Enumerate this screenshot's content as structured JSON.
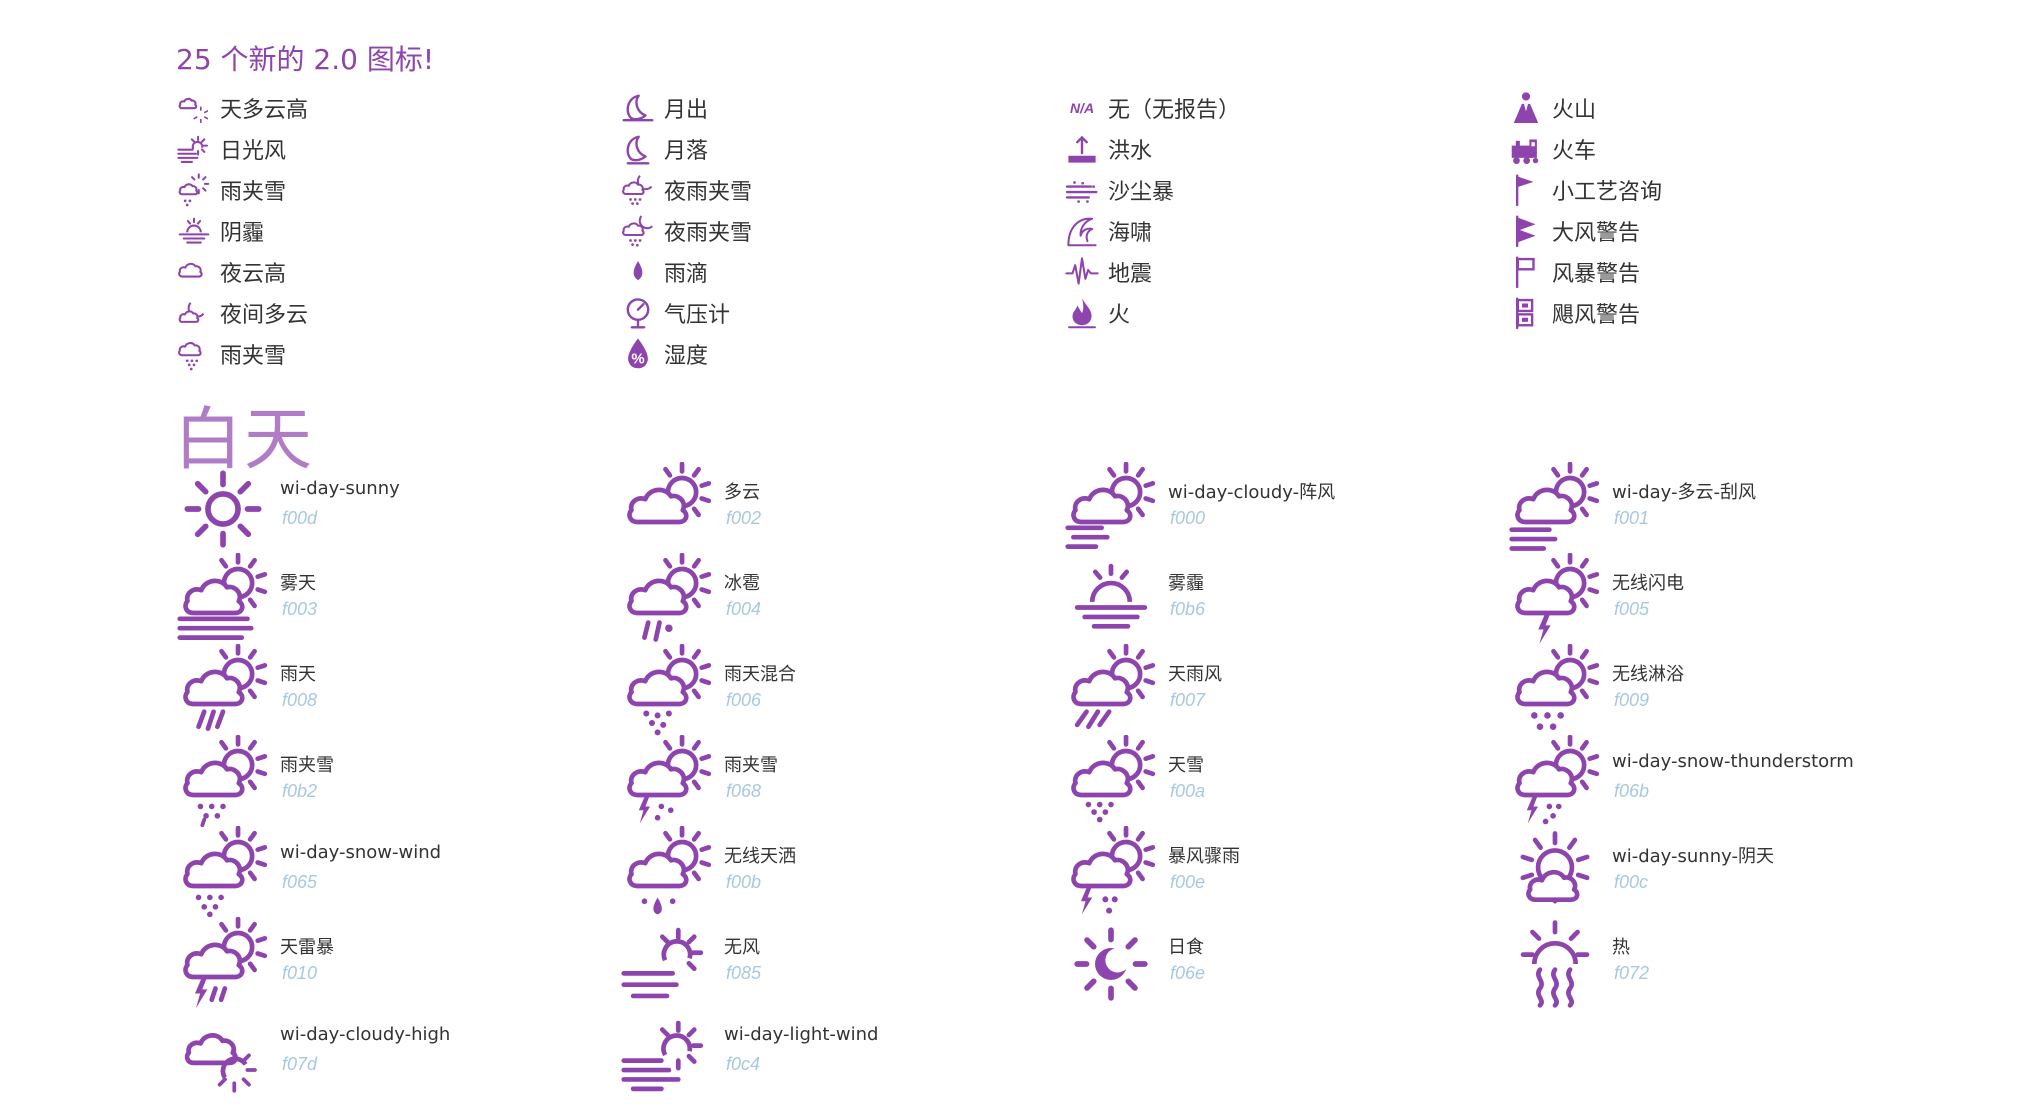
{
  "colors": {
    "accent": "#8e44ad",
    "heading_light": "#b07cc6",
    "code": "#a8c8e0",
    "text": "#333333"
  },
  "new_section": {
    "title": "25 个新的 2.0 图标!",
    "columns": [
      [
        {
          "icon": "day-cloudy-high-icon",
          "label": "天多云高"
        },
        {
          "icon": "day-light-wind-icon",
          "label": "日光风"
        },
        {
          "icon": "day-sleet-icon",
          "label": "雨夹雪"
        },
        {
          "icon": "day-haze-icon",
          "label": "阴霾"
        },
        {
          "icon": "night-cloudy-high-icon",
          "label": "夜云高"
        },
        {
          "icon": "night-partly-cloudy-icon",
          "label": "夜间多云"
        },
        {
          "icon": "sleet-icon",
          "label": "雨夹雪"
        }
      ],
      [
        {
          "icon": "moonrise-icon",
          "label": "月出"
        },
        {
          "icon": "moonset-icon",
          "label": "月落"
        },
        {
          "icon": "night-sleet-icon",
          "label": "夜雨夹雪"
        },
        {
          "icon": "night-alt-sleet-icon",
          "label": "夜雨夹雪"
        },
        {
          "icon": "raindrop-icon",
          "label": "雨滴"
        },
        {
          "icon": "barometer-icon",
          "label": "气压计"
        },
        {
          "icon": "humidity-icon",
          "label": "湿度"
        }
      ],
      [
        {
          "icon": "na-icon",
          "label": "无（无报告）",
          "glyph": "N/A"
        },
        {
          "icon": "flood-icon",
          "label": "洪水"
        },
        {
          "icon": "sandstorm-icon",
          "label": "沙尘暴"
        },
        {
          "icon": "tsunami-icon",
          "label": "海啸"
        },
        {
          "icon": "earthquake-icon",
          "label": "地震"
        },
        {
          "icon": "fire-icon",
          "label": "火"
        }
      ],
      [
        {
          "icon": "volcano-icon",
          "label": "火山"
        },
        {
          "icon": "train-icon",
          "label": "火车"
        },
        {
          "icon": "small-craft-advisory-icon",
          "label": "小工艺咨询"
        },
        {
          "icon": "gale-warning-icon",
          "label": "大风警告"
        },
        {
          "icon": "storm-warning-icon",
          "label": "风暴警告"
        },
        {
          "icon": "hurricane-warning-icon",
          "label": "飓风警告"
        }
      ]
    ]
  },
  "day_section": {
    "heading": "白天",
    "columns": [
      [
        {
          "icon": "day-sunny-icon",
          "name": "wi-day-sunny",
          "code": "f00d"
        },
        {
          "icon": "day-fog-icon",
          "name": "雾天",
          "code": "f003"
        },
        {
          "icon": "day-rain-icon",
          "name": "雨天",
          "code": "f008"
        },
        {
          "icon": "day-sleet-icon",
          "name": "雨夹雪",
          "code": "f0b2"
        },
        {
          "icon": "day-snow-wind-icon",
          "name": "wi-day-snow-wind",
          "code": "f065"
        },
        {
          "icon": "day-thunderstorm-icon",
          "name": "天雷暴",
          "code": "f010"
        },
        {
          "icon": "day-cloudy-high-icon",
          "name": "wi-day-cloudy-high",
          "code": "f07d"
        }
      ],
      [
        {
          "icon": "day-cloudy-icon",
          "name": "多云",
          "code": "f002"
        },
        {
          "icon": "day-hail-icon",
          "name": "冰雹",
          "code": "f004"
        },
        {
          "icon": "day-rain-mix-icon",
          "name": "雨天混合",
          "code": "f006"
        },
        {
          "icon": "day-sleet-storm-icon",
          "name": "雨夹雪",
          "code": "f068"
        },
        {
          "icon": "day-sprinkle-icon",
          "name": "无线天洒",
          "code": "f00b"
        },
        {
          "icon": "day-windy-icon",
          "name": "无风",
          "code": "f085"
        },
        {
          "icon": "day-light-wind-icon",
          "name": "wi-day-light-wind",
          "code": "f0c4"
        }
      ],
      [
        {
          "icon": "day-cloudy-gusts-icon",
          "name": "wi-day-cloudy-阵风",
          "code": "f000"
        },
        {
          "icon": "day-haze-icon",
          "name": "雾霾",
          "code": "f0b6"
        },
        {
          "icon": "day-rain-wind-icon",
          "name": "天雨风",
          "code": "f007"
        },
        {
          "icon": "day-snow-icon",
          "name": "天雪",
          "code": "f00a"
        },
        {
          "icon": "day-storm-showers-icon",
          "name": "暴风骤雨",
          "code": "f00e"
        },
        {
          "icon": "solar-eclipse-icon",
          "name": "日食",
          "code": "f06e"
        }
      ],
      [
        {
          "icon": "day-cloudy-windy-icon",
          "name": "wi-day-多云-刮风",
          "code": "f001"
        },
        {
          "icon": "day-lightning-icon",
          "name": "无线闪电",
          "code": "f005"
        },
        {
          "icon": "day-showers-icon",
          "name": "无线淋浴",
          "code": "f009"
        },
        {
          "icon": "day-snow-thunderstorm-icon",
          "name": "wi-day-snow-thunderstorm",
          "code": "f06b"
        },
        {
          "icon": "day-sunny-overcast-icon",
          "name": "wi-day-sunny-阴天",
          "code": "f00c"
        },
        {
          "icon": "hot-icon",
          "name": "热",
          "code": "f072"
        }
      ]
    ]
  }
}
